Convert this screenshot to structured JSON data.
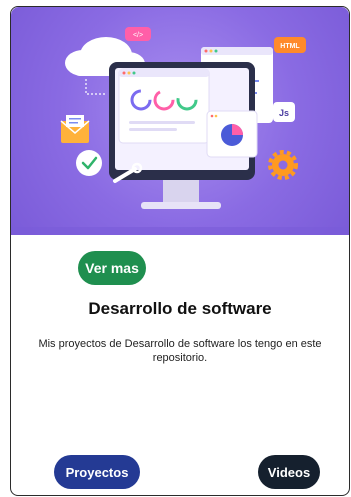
{
  "hero": {
    "image_icon": "software-development-illustration",
    "code_tag": "</>",
    "html_badge": "HTML",
    "js_badge": "Js"
  },
  "card": {
    "cta_label": "Ver mas",
    "title": "Desarrollo de software",
    "description": "Mis proyectos de Desarrollo de software los tengo en este repositorio.",
    "projects_label": "Proyectos",
    "videos_label": "Videos"
  },
  "colors": {
    "hero_purple": "#8a6be3",
    "cta_green": "#1f8f4f",
    "projects_blue": "#243a94",
    "videos_dark": "#15202e"
  }
}
